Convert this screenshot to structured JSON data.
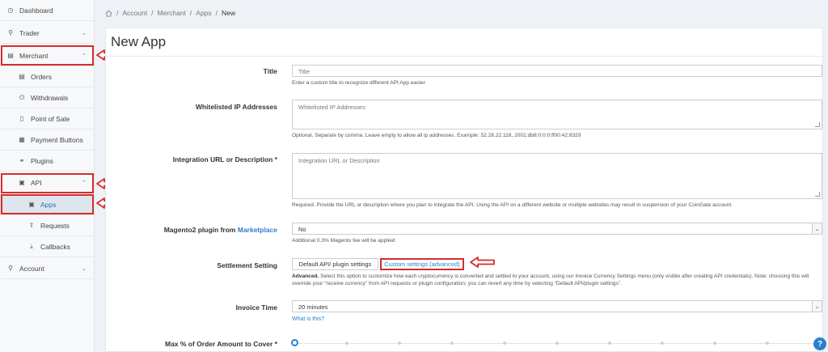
{
  "sidebar": {
    "items": [
      {
        "label": "Dashboard",
        "icon": "clock-icon"
      },
      {
        "label": "Trader",
        "icon": "user-icon"
      },
      {
        "label": "Merchant",
        "icon": "merchant-icon"
      },
      {
        "label": "Orders",
        "icon": "list-icon"
      },
      {
        "label": "Withdrawals",
        "icon": "power-icon"
      },
      {
        "label": "Point of Sale",
        "icon": "document-icon"
      },
      {
        "label": "Payment Buttons",
        "icon": "grid-icon"
      },
      {
        "label": "Plugins",
        "icon": "link-icon"
      },
      {
        "label": "API",
        "icon": "terminal-icon"
      },
      {
        "label": "Apps",
        "icon": "terminal-icon"
      },
      {
        "label": "Requests",
        "icon": "upload-icon"
      },
      {
        "label": "Callbacks",
        "icon": "download-icon"
      },
      {
        "label": "Account",
        "icon": "user-icon"
      }
    ]
  },
  "breadcrumb": [
    "Account",
    "Merchant",
    "Apps",
    "New"
  ],
  "page": {
    "title": "New App"
  },
  "form": {
    "title_label": "Title",
    "title_placeholder": "Title",
    "title_help": "Enter a custom title to recognize different API App easier",
    "whitelist_label": "Whitelisted IP Addresses",
    "whitelist_placeholder": "Whitelisted IP Addresses",
    "whitelist_help": "Optional. Separate by comma. Leave empty to allow all ip addresses. Example: 52.28.22.118, 2001:db8:0:0:0:ff00:42:8329",
    "integration_label": "Integration URL or Description *",
    "integration_placeholder": "Integration URL or Description",
    "integration_help": "Required. Provide the URL or description where you plan to integrate the API. Using the API on a different website or multiple websites may result in suspension of your CoinGate account.",
    "magento_label": "Magento2 plugin from",
    "magento_link": "Marketplace",
    "magento_value": "No",
    "magento_help": "Additional 0.3% Magento fee will be applied",
    "settlement_label": "Settlement Setting",
    "settlement_default": "Default API/ plugin settings",
    "settlement_custom": "Custom settings (advanced)",
    "settlement_help_bold": "Advanced.",
    "settlement_help": "Select this option to customize how each cryptocurrency is converted and settled to your account, using our Invoice Currency Settings menu (only visible after creating API credentials). Note: choosing this will override your “receive currency” from API requests or plugin configuration; you can revert any time by selecting “Default API/plugin settings”.",
    "invoice_label": "Invoice Time",
    "invoice_value": "20 minutes",
    "invoice_link": "What is this?",
    "max_label": "Max % of Order Amount to Cover *"
  },
  "help_bubble": "?",
  "colors": {
    "accent": "#2b7fcf",
    "highlight": "#d42d2d"
  }
}
